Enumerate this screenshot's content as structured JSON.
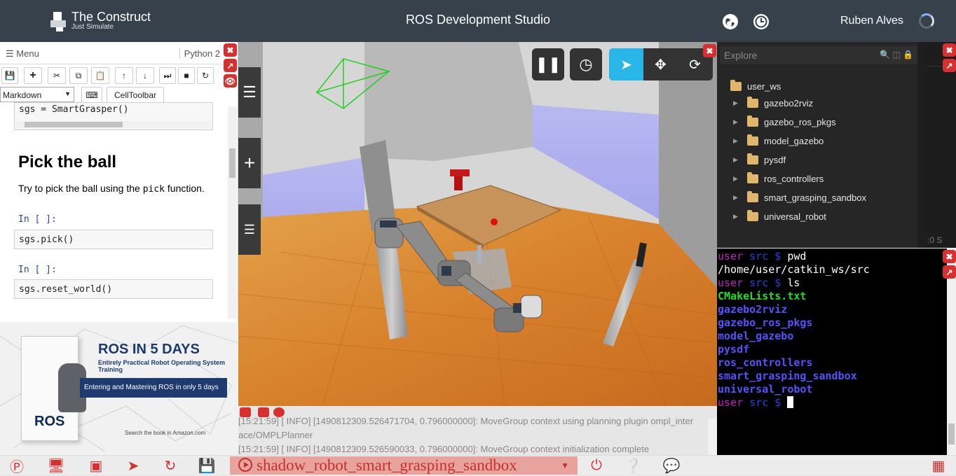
{
  "header": {
    "logo_title": "The Construct",
    "logo_subtitle": "Just Simulate",
    "app_title": "ROS Development Studio",
    "user_name": "Ruben Alves"
  },
  "notebook": {
    "menu_label": "Menu",
    "kernel_label": "Python 2",
    "cell_type": "Markdown",
    "celltoolbar_label": "CellToolbar",
    "code_top": "sgs = SmartGrasper()",
    "heading": "Pick the ball",
    "para_before": "Try to pick the ball using the ",
    "para_code": "pick",
    "para_after": " function.",
    "prompt1": "In [ ]:",
    "code1": "sgs.pick()",
    "prompt2": "In [ ]:",
    "code2": "sgs.reset_world()"
  },
  "ad": {
    "title": "ROS IN 5 DAYS",
    "subtitle": "Entirely Practical Robot Operating System Training",
    "band": "Entering and Mastering ROS in only 5 days",
    "book_title": "ROS",
    "search": "Search the book in Amazon.com"
  },
  "console": {
    "lines": [
      "[15:21:59] [ INFO] [1490812309.526471704, 0.796000000]: MoveGroup context using planning plugin ompl_inter",
      "ace/OMPLPlanner",
      "[15:21:59] [ INFO] [1490812309.526590033, 0.796000000]: MoveGroup context initialization complete"
    ]
  },
  "explorer": {
    "placeholder": "Explore",
    "root": "user_ws",
    "items": [
      "gazebo2rviz",
      "gazebo_ros_pkgs",
      "model_gazebo",
      "pysdf",
      "ros_controllers",
      "smart_grasping_sandbox",
      "universal_robot"
    ],
    "right_text": ":0 S"
  },
  "terminal": {
    "prompt_user": "user",
    "prompt_dir": "src",
    "prompt_sym": "$",
    "cmd1": "pwd",
    "out1": "/home/user/catkin_ws/src",
    "cmd2": "ls",
    "file1": "CMakeLists.txt",
    "dirs": [
      "gazebo2rviz",
      "gazebo_ros_pkgs",
      "model_gazebo",
      "pysdf",
      "ros_controllers",
      "smart_grasping_sandbox",
      "universal_robot"
    ]
  },
  "bottom": {
    "workspace": "shadow_robot_smart_grasping_sandbox"
  },
  "colors": {
    "header_bg": "#36414b",
    "accent_red": "#d9302f",
    "gazebo_select": "#29b6e8",
    "terminal_user": "#c61ec6",
    "terminal_green": "#1ee01e"
  }
}
